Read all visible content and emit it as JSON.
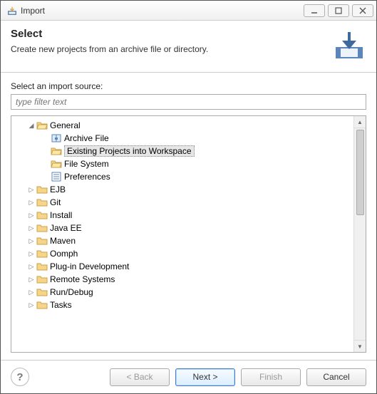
{
  "window": {
    "title": "Import"
  },
  "header": {
    "title": "Select",
    "description": "Create new projects from an archive file or directory."
  },
  "body": {
    "source_label": "Select an import source:",
    "filter_placeholder": "type filter text"
  },
  "tree": {
    "expanded": {
      "label": "General",
      "children": [
        {
          "label": "Archive File",
          "icon": "archive",
          "selected": false
        },
        {
          "label": "Existing Projects into Workspace",
          "icon": "folder-open",
          "selected": true
        },
        {
          "label": "File System",
          "icon": "folder-open",
          "selected": false
        },
        {
          "label": "Preferences",
          "icon": "preferences",
          "selected": false
        }
      ]
    },
    "collapsed": [
      "EJB",
      "Git",
      "Install",
      "Java EE",
      "Maven",
      "Oomph",
      "Plug-in Development",
      "Remote Systems",
      "Run/Debug",
      "Tasks"
    ]
  },
  "footer": {
    "back": "< Back",
    "next": "Next >",
    "finish": "Finish",
    "cancel": "Cancel"
  }
}
